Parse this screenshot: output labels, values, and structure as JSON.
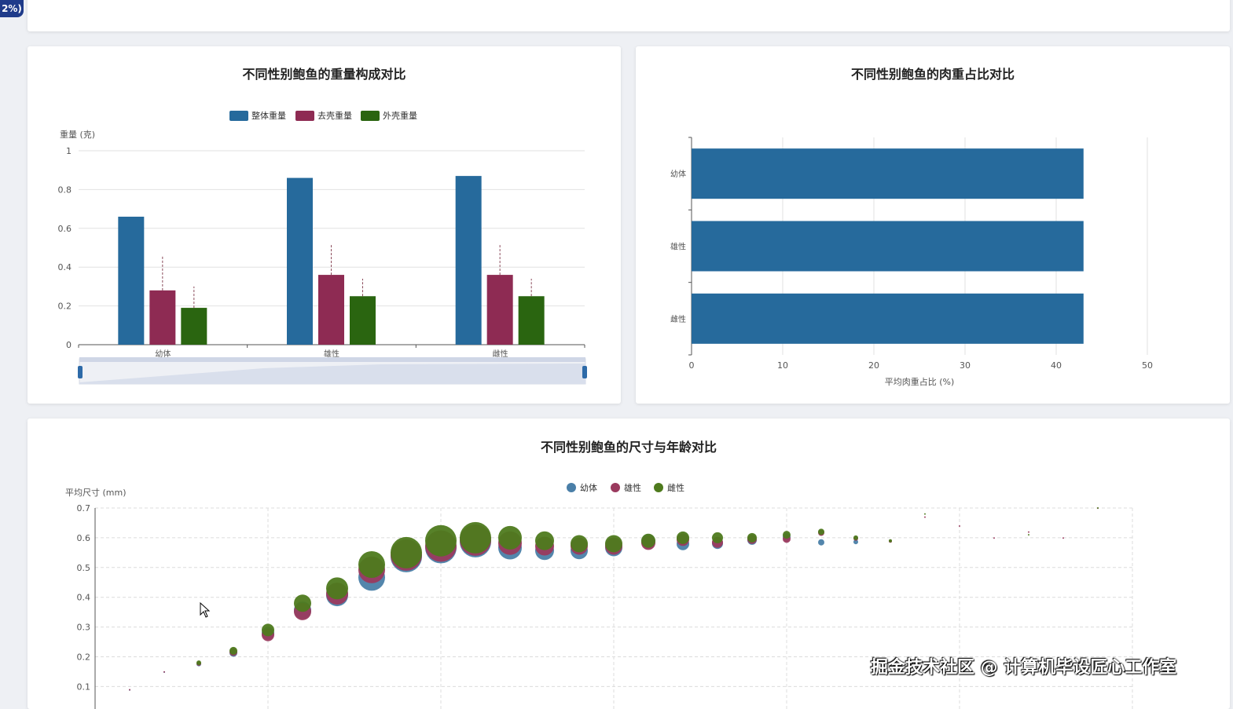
{
  "badge": "2%)",
  "watermark": "掘金技术社区 @ 计算机毕设匠心工作室",
  "colors": {
    "blue": "#266a9c",
    "red": "#8e2b53",
    "green": "#2a6510",
    "grid": "#e2e2e2",
    "axis": "#555555"
  },
  "chart_data": [
    {
      "type": "bar",
      "title": "不同性别鲍鱼的重量构成对比",
      "ylabel": "重量 (克)",
      "ylim": [
        0,
        1
      ],
      "yticks": [
        "0",
        "0.2",
        "0.4",
        "0.6",
        "0.8",
        "1"
      ],
      "categories": [
        "幼体",
        "雄性",
        "雌性"
      ],
      "legend_position": "top-center",
      "grid": true,
      "datazoom": true,
      "series": [
        {
          "name": "整体重量",
          "color": "#266a9c",
          "values": [
            0.66,
            0.86,
            0.87
          ]
        },
        {
          "name": "去壳重量",
          "color": "#8e2b53",
          "values": [
            0.28,
            0.36,
            0.36
          ],
          "error_upper": [
            0.46,
            0.52,
            0.52
          ]
        },
        {
          "name": "外壳重量",
          "color": "#2a6510",
          "values": [
            0.19,
            0.25,
            0.25
          ],
          "error_upper": [
            0.3,
            0.34,
            0.34
          ]
        }
      ]
    },
    {
      "type": "bar",
      "orientation": "horizontal",
      "title": "不同性别鲍鱼的肉重占比对比",
      "xlabel": "平均肉重占比 (%)",
      "xlim": [
        0,
        50
      ],
      "xticks": [
        "0",
        "10",
        "20",
        "30",
        "40",
        "50"
      ],
      "categories": [
        "幼体",
        "雄性",
        "雌性"
      ],
      "grid": true,
      "series": [
        {
          "color": "#266a9c",
          "values": [
            43,
            43,
            43
          ]
        }
      ]
    },
    {
      "type": "scatter",
      "title": "不同性别鲍鱼的尺寸与年龄对比",
      "ylabel": "平均尺寸 (mm)",
      "ylim": [
        0,
        0.7
      ],
      "yticks": [
        "0.1",
        "0.2",
        "0.3",
        "0.4",
        "0.5",
        "0.6",
        "0.7"
      ],
      "legend_position": "top-center",
      "grid": true,
      "x": [
        1,
        2,
        3,
        4,
        5,
        6,
        7,
        8,
        9,
        10,
        11,
        12,
        13,
        14,
        15,
        16,
        17,
        18,
        19,
        20,
        21,
        22,
        23,
        24,
        25,
        26,
        27,
        28,
        29,
        30
      ],
      "series": [
        {
          "name": "幼体",
          "color": "#4a7fa8",
          "values": [
            0.09,
            0.15,
            0.18,
            0.22,
            0.29,
            0.37,
            0.42,
            0.48,
            0.55,
            0.58,
            0.6,
            0.58,
            0.57,
            0.57,
            0.58,
            0.6,
            0.59,
            0.59,
            0.6,
            0.61,
            0.59,
            0.59,
            null,
            null,
            null,
            null,
            null,
            null,
            null,
            null
          ],
          "sizes": [
            1,
            1,
            3,
            5,
            8,
            11,
            14,
            17,
            20,
            20,
            20,
            15,
            12,
            11,
            11,
            9,
            8,
            7,
            6,
            5,
            4,
            3,
            null,
            null,
            null,
            null,
            null,
            null,
            null,
            null
          ]
        },
        {
          "name": "雄性",
          "color": "#9a3a5e",
          "values": [
            0.09,
            0.15,
            0.18,
            0.22,
            0.28,
            0.36,
            0.42,
            0.5,
            0.55,
            0.58,
            0.6,
            0.59,
            0.58,
            0.58,
            0.58,
            0.59,
            0.6,
            0.59,
            0.6,
            0.6,
            0.62,
            0.6,
            0.59,
            0.67,
            0.64,
            0.6,
            0.62,
            0.6,
            0.7,
            null
          ],
          "sizes": [
            1,
            1,
            3,
            5,
            8,
            11,
            14,
            17,
            20,
            20,
            20,
            15,
            12,
            11,
            11,
            9,
            8,
            7,
            6,
            5,
            4,
            3,
            2,
            1,
            1,
            1,
            1,
            1,
            1,
            null
          ]
        },
        {
          "name": "雌性",
          "color": "#4e7a1d",
          "values": [
            null,
            null,
            0.18,
            0.22,
            0.29,
            0.38,
            0.43,
            0.51,
            0.55,
            0.59,
            0.6,
            0.6,
            0.59,
            0.58,
            0.58,
            0.59,
            0.6,
            0.6,
            0.6,
            0.61,
            0.62,
            0.6,
            0.59,
            0.68,
            null,
            null,
            0.61,
            null,
            0.7,
            null
          ],
          "sizes": [
            null,
            null,
            3,
            5,
            8,
            11,
            14,
            17,
            20,
            20,
            20,
            15,
            12,
            11,
            11,
            9,
            8,
            7,
            6,
            5,
            4,
            3,
            2,
            1,
            null,
            null,
            1,
            null,
            1,
            null
          ]
        }
      ]
    }
  ]
}
